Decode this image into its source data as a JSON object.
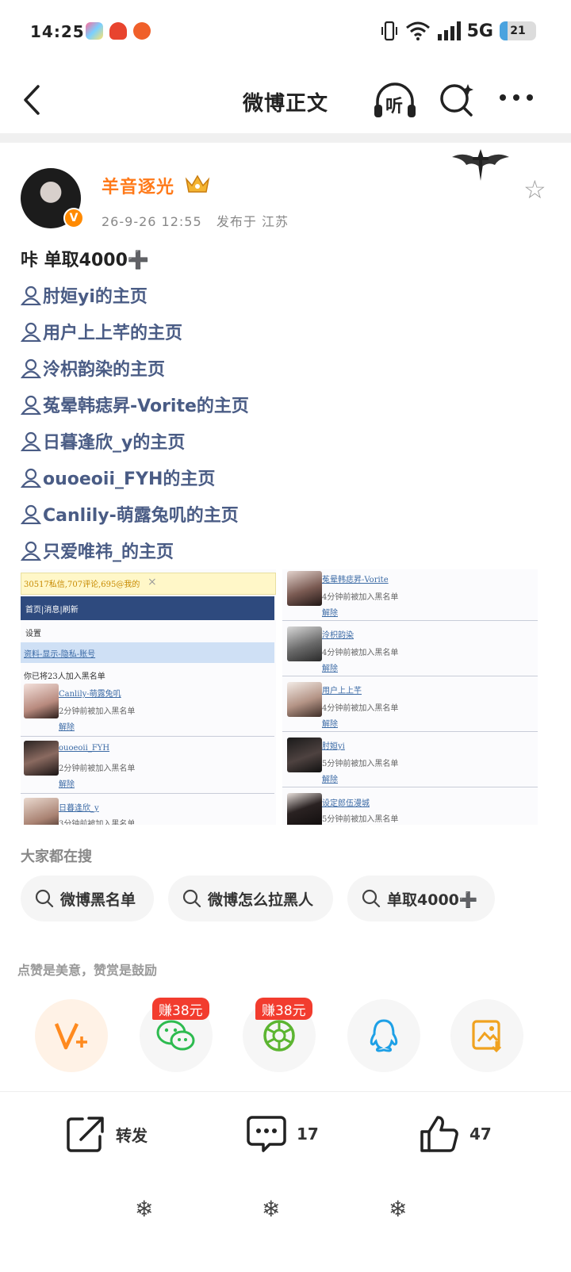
{
  "status_bar": {
    "time": "14:25",
    "network": "5G",
    "battery": "21"
  },
  "nav": {
    "title": "微博正文",
    "listen_label": "听"
  },
  "post": {
    "author": "羊音逐光",
    "date": "26-9-26 12:55",
    "location": "发布于 江苏",
    "text": "咔 单取4000➕",
    "mentions": [
      "肘姮yi的主页",
      "用户上上芊的主页",
      "泠枳韵染的主页",
      "菟晕韩痣昇-Vorite的主页",
      "日暮逢欣_y的主页",
      "ouoeoii_FYH的主页",
      "Canlily-萌露兔叽的主页",
      "只爱唯祎_的主页"
    ]
  },
  "screenshot_left": {
    "banner": "30517私信,707评论,695@我的",
    "menu": "首页|消息|刷新",
    "settings": "设置",
    "tabs": "资料-显示-隐私-账号",
    "count": "你已将23人加入黑名单",
    "users": [
      {
        "name": "Canlily-萌露兔叽",
        "time": "2分钟前被加入黑名单",
        "action": "解除"
      },
      {
        "name": "ouoeoii_FYH",
        "time": "2分钟前被加入黑名单",
        "action": "解除"
      },
      {
        "name": "日暮逢欣_y",
        "time": "3分钟前被加入黑名单",
        "action": ""
      }
    ]
  },
  "screenshot_right": {
    "users": [
      {
        "name": "菟晕韩痣昇-Vorite",
        "time": "4分钟前被加入黑名单",
        "action": "解除"
      },
      {
        "name": "泠枳韵染",
        "time": "4分钟前被加入黑名单",
        "action": "解除"
      },
      {
        "name": "用户上上芊",
        "time": "4分钟前被加入黑名单",
        "action": "解除"
      },
      {
        "name": "肘姮yi",
        "time": "5分钟前被加入黑名单",
        "action": "解除"
      },
      {
        "name": "设定郎伍漫城",
        "time": "5分钟前被加入黑名单",
        "action": ""
      }
    ]
  },
  "search": {
    "title": "大家都在搜",
    "chips": [
      "微博黑名单",
      "微博怎么拉黑人",
      "单取4000➕"
    ]
  },
  "reward": {
    "title": "点赞是美意，赞赏是鼓励",
    "tags": [
      "赚38元",
      "赚38元"
    ]
  },
  "actions": {
    "repost_label": "转发",
    "comments": "17",
    "likes": "47"
  },
  "colors": {
    "username": "#ff7a1a",
    "link": "#4a5c85",
    "tag": "#f23c2e"
  }
}
